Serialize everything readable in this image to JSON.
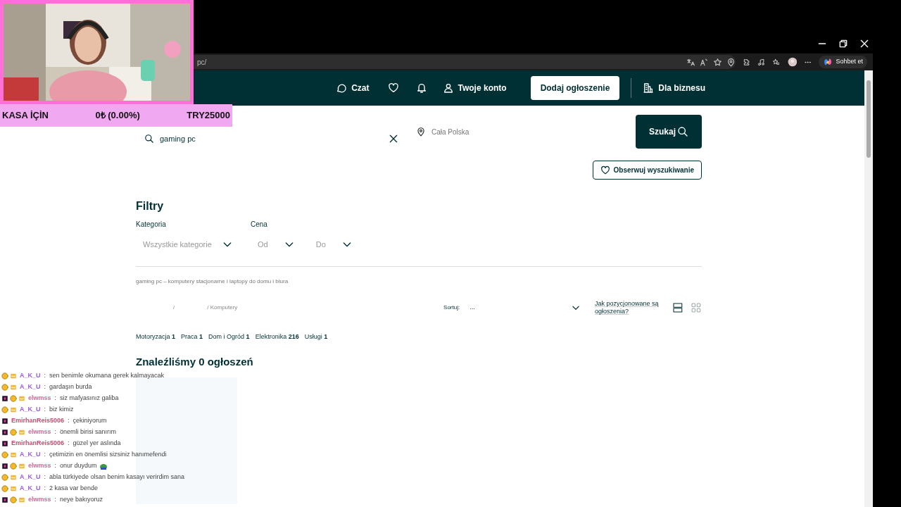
{
  "overlay": {
    "goal_label": "KASA İÇİN",
    "goal_amount": "0₺ (0.00%)",
    "goal_target": "TRY25000"
  },
  "browser": {
    "url": "pc/",
    "copilot_label": "Sohbet et"
  },
  "nav": {
    "items": [
      {
        "kind": "chat",
        "label": "Czat"
      },
      {
        "kind": "heart"
      },
      {
        "kind": "bell"
      },
      {
        "kind": "account",
        "label": "Twoje konto"
      },
      {
        "kind": "cta",
        "label": "Dodaj ogłoszenie"
      },
      {
        "kind": "business",
        "label": "Dla biznesu"
      }
    ]
  },
  "search": {
    "query": "gaming pc",
    "location_placeholder": "Cała Polska",
    "button": "Szukaj",
    "observe_button": "Obserwuj wyszukiwanie"
  },
  "filters": {
    "title": "Filtry",
    "category_label": "Kategoria",
    "category_placeholder": "Wszystkie kategorie",
    "price_label": "Cena",
    "price_from": "Od",
    "price_to": "Do"
  },
  "description": "gaming pc – komputery stacjonarne i laptopy do domu i biura",
  "breadcrumb": [
    "/",
    "/ Komputery"
  ],
  "sort": {
    "label": "Sortuj:",
    "value": "...",
    "help_link": "Jak pozycjonowane są ogłoszenia?",
    "views": [
      {
        "kind": "list",
        "selected": true
      },
      {
        "kind": "grid",
        "selected": false
      }
    ]
  },
  "category_counts": [
    {
      "name": "Motoryzacja",
      "count": "1"
    },
    {
      "name": "Praca",
      "count": "1"
    },
    {
      "name": "Dom i Ogród",
      "count": "1"
    },
    {
      "name": "Elektronika",
      "count": "216"
    },
    {
      "name": "Usługi",
      "count": "1"
    }
  ],
  "results_heading": "Znaleźliśmy 0 ogłoszeń",
  "chat": [
    {
      "kind": "member",
      "user": "A_K_U",
      "color": "#9b5de5",
      "separator": ":",
      "message": "sen benimle okumana gerek kalmayacak"
    },
    {
      "kind": "member",
      "user": "A_K_U",
      "color": "#9b5de5",
      "separator": ":",
      "message": "gardaşın burda"
    },
    {
      "kind": "gifter",
      "user": "elwmss",
      "color": "#d46a9a",
      "separator": ":",
      "message": "siz mafyasınız galiba"
    },
    {
      "kind": "member",
      "user": "A_K_U",
      "color": "#9b5de5",
      "separator": ":",
      "message": "biz kimiz"
    },
    {
      "kind": "plain",
      "user": "EmirhanReis5006",
      "color": "#c2506e",
      "separator": ":",
      "message": "çekiniyorum"
    },
    {
      "kind": "gifter",
      "user": "elwmss",
      "color": "#d46a9a",
      "separator": ":",
      "message": "önemli birisi sanırım"
    },
    {
      "kind": "plain",
      "user": "EmirhanReis5006",
      "color": "#c2506e",
      "separator": ":",
      "message": "güzel yer aslında"
    },
    {
      "kind": "member",
      "user": "A_K_U",
      "color": "#9b5de5",
      "separator": ":",
      "message": "çetimizin en önemlisi sizsiniz hanımefendi"
    },
    {
      "kind": "gifter",
      "user": "elwmss",
      "color": "#d46a9a",
      "separator": ":",
      "message": "onur duydum",
      "emote": true
    },
    {
      "kind": "member",
      "user": "A_K_U",
      "color": "#9b5de5",
      "separator": ":",
      "message": "abla türkiyede olsan benim kasayı verirdim sana"
    },
    {
      "kind": "member",
      "user": "A_K_U",
      "color": "#9b5de5",
      "separator": ":",
      "message": "2 kasa var bende"
    },
    {
      "kind": "gifter",
      "user": "elwmss",
      "color": "#d46a9a",
      "separator": ":",
      "message": "neye bakıyoruz"
    }
  ]
}
